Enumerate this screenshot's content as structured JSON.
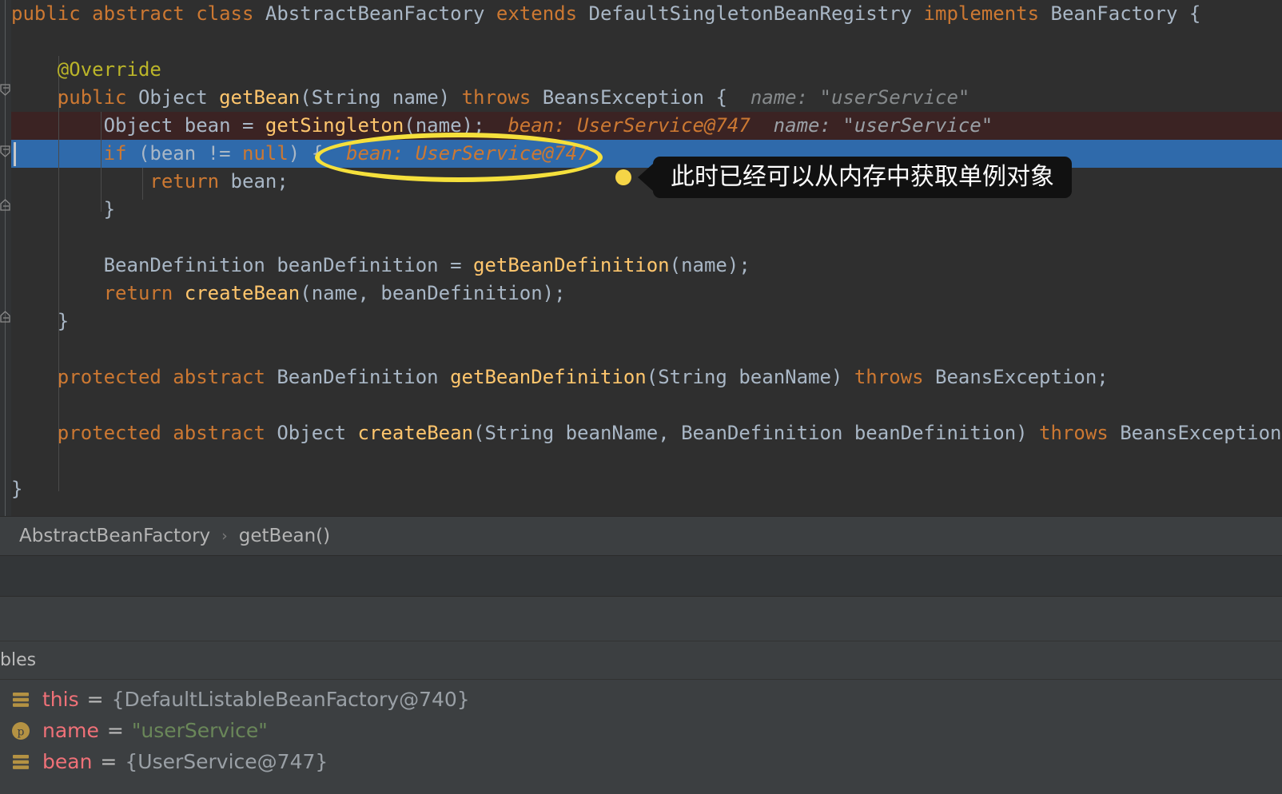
{
  "window": {
    "theme_bg": "#2b2b2b",
    "editor_bg": "#2f2f2f",
    "panel_bg": "#3c3f41",
    "exec_line_color": "#2f6aab",
    "breakpoint_line_color": "#3b2323",
    "accent_yellow": "#f5e03c"
  },
  "editor": {
    "lines": [
      {
        "id": "l1",
        "text": "public abstract class AbstractBeanFactory extends DefaultSingletonBeanRegistry implements BeanFactory {"
      },
      {
        "id": "l2",
        "text": ""
      },
      {
        "id": "l3",
        "text": "    @Override"
      },
      {
        "id": "l4",
        "text": "    public Object getBean(String name) throws BeansException {",
        "hint": "name: \"userService\""
      },
      {
        "id": "l5",
        "text": "        Object bean = getSingleton(name);",
        "hint_bean": "bean: UserService@747",
        "hint_name": "name: \"userService\"",
        "state": "breakpoint"
      },
      {
        "id": "l6",
        "text": "        if (bean != null) {",
        "hint_bean": "bean: UserService@747",
        "state": "executing"
      },
      {
        "id": "l7",
        "text": "            return bean;"
      },
      {
        "id": "l8",
        "text": "        }"
      },
      {
        "id": "l9",
        "text": ""
      },
      {
        "id": "l10",
        "text": "        BeanDefinition beanDefinition = getBeanDefinition(name);"
      },
      {
        "id": "l11",
        "text": "        return createBean(name, beanDefinition);"
      },
      {
        "id": "l12",
        "text": "    }"
      },
      {
        "id": "l13",
        "text": ""
      },
      {
        "id": "l14",
        "text": "    protected abstract BeanDefinition getBeanDefinition(String beanName) throws BeansException;"
      },
      {
        "id": "l15",
        "text": ""
      },
      {
        "id": "l16",
        "text": "    protected abstract Object createBean(String beanName, BeanDefinition beanDefinition) throws BeansException;"
      },
      {
        "id": "l17",
        "text": ""
      },
      {
        "id": "l18",
        "text": "}"
      }
    ],
    "inline_hints": {
      "line4_name": "name: \"userService\"",
      "line5_bean": "bean: UserService@747",
      "line5_name": "name: \"userService\"",
      "line6_bean": "bean: UserService@747"
    }
  },
  "annotation": {
    "tooltip_text": "此时已经可以从内存中获取单例对象",
    "ellipse_target": "bean: UserService@747",
    "dot_color": "#f5d547",
    "tooltip_bg": "#111111"
  },
  "breadcrumb": {
    "class_name": "AbstractBeanFactory",
    "separator": "›",
    "method_name": "getBean()"
  },
  "debugger": {
    "variables_tab_label": "bles",
    "variables": [
      {
        "icon": "object-icon",
        "name": "this",
        "eq": "=",
        "value": "{DefaultListableBeanFactory@740}",
        "value_type": "object"
      },
      {
        "icon": "parameter-icon",
        "name": "name",
        "eq": "=",
        "value": "\"userService\"",
        "value_type": "string"
      },
      {
        "icon": "object-icon",
        "name": "bean",
        "eq": "=",
        "value": "{UserService@747}",
        "value_type": "object"
      }
    ]
  }
}
